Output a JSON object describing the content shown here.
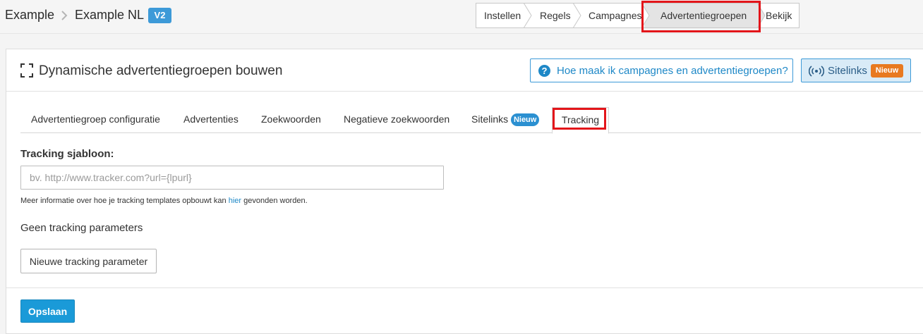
{
  "breadcrumb": {
    "root": "Example",
    "current": "Example NL",
    "version_badge": "V2"
  },
  "steps": [
    {
      "label": "Instellen"
    },
    {
      "label": "Regels"
    },
    {
      "label": "Campagnes"
    },
    {
      "label": "Advertentiegroepen",
      "active": true
    },
    {
      "label": "Bekijk"
    }
  ],
  "header": {
    "title": "Dynamische advertentiegroepen bouwen",
    "help_button": "Hoe maak ik campagnes en advertentiegroepen?",
    "help_icon_glyph": "?",
    "sitelinks_button": "Sitelinks",
    "sitelinks_badge": "Nieuw"
  },
  "tabs": [
    {
      "label": "Advertentiegroep configuratie"
    },
    {
      "label": "Advertenties"
    },
    {
      "label": "Zoekwoorden"
    },
    {
      "label": "Negatieve zoekwoorden"
    },
    {
      "label": "Sitelinks",
      "badge": "Nieuw"
    },
    {
      "label": "Tracking",
      "active": true
    }
  ],
  "form": {
    "tracking_label": "Tracking sjabloon:",
    "tracking_value": "",
    "tracking_placeholder": "bv. http://www.tracker.com?url={lpurl}",
    "help_prefix": "Meer informatie over hoe je tracking templates opbouwt kan ",
    "help_link": "hier",
    "help_suffix": " gevonden worden.",
    "no_params": "Geen tracking parameters",
    "new_param_button": "Nieuwe tracking parameter",
    "save_button": "Opslaan"
  },
  "colors": {
    "accent_blue": "#1a9ad8",
    "badge_orange": "#e8791f",
    "highlight_red": "#e3151a"
  }
}
